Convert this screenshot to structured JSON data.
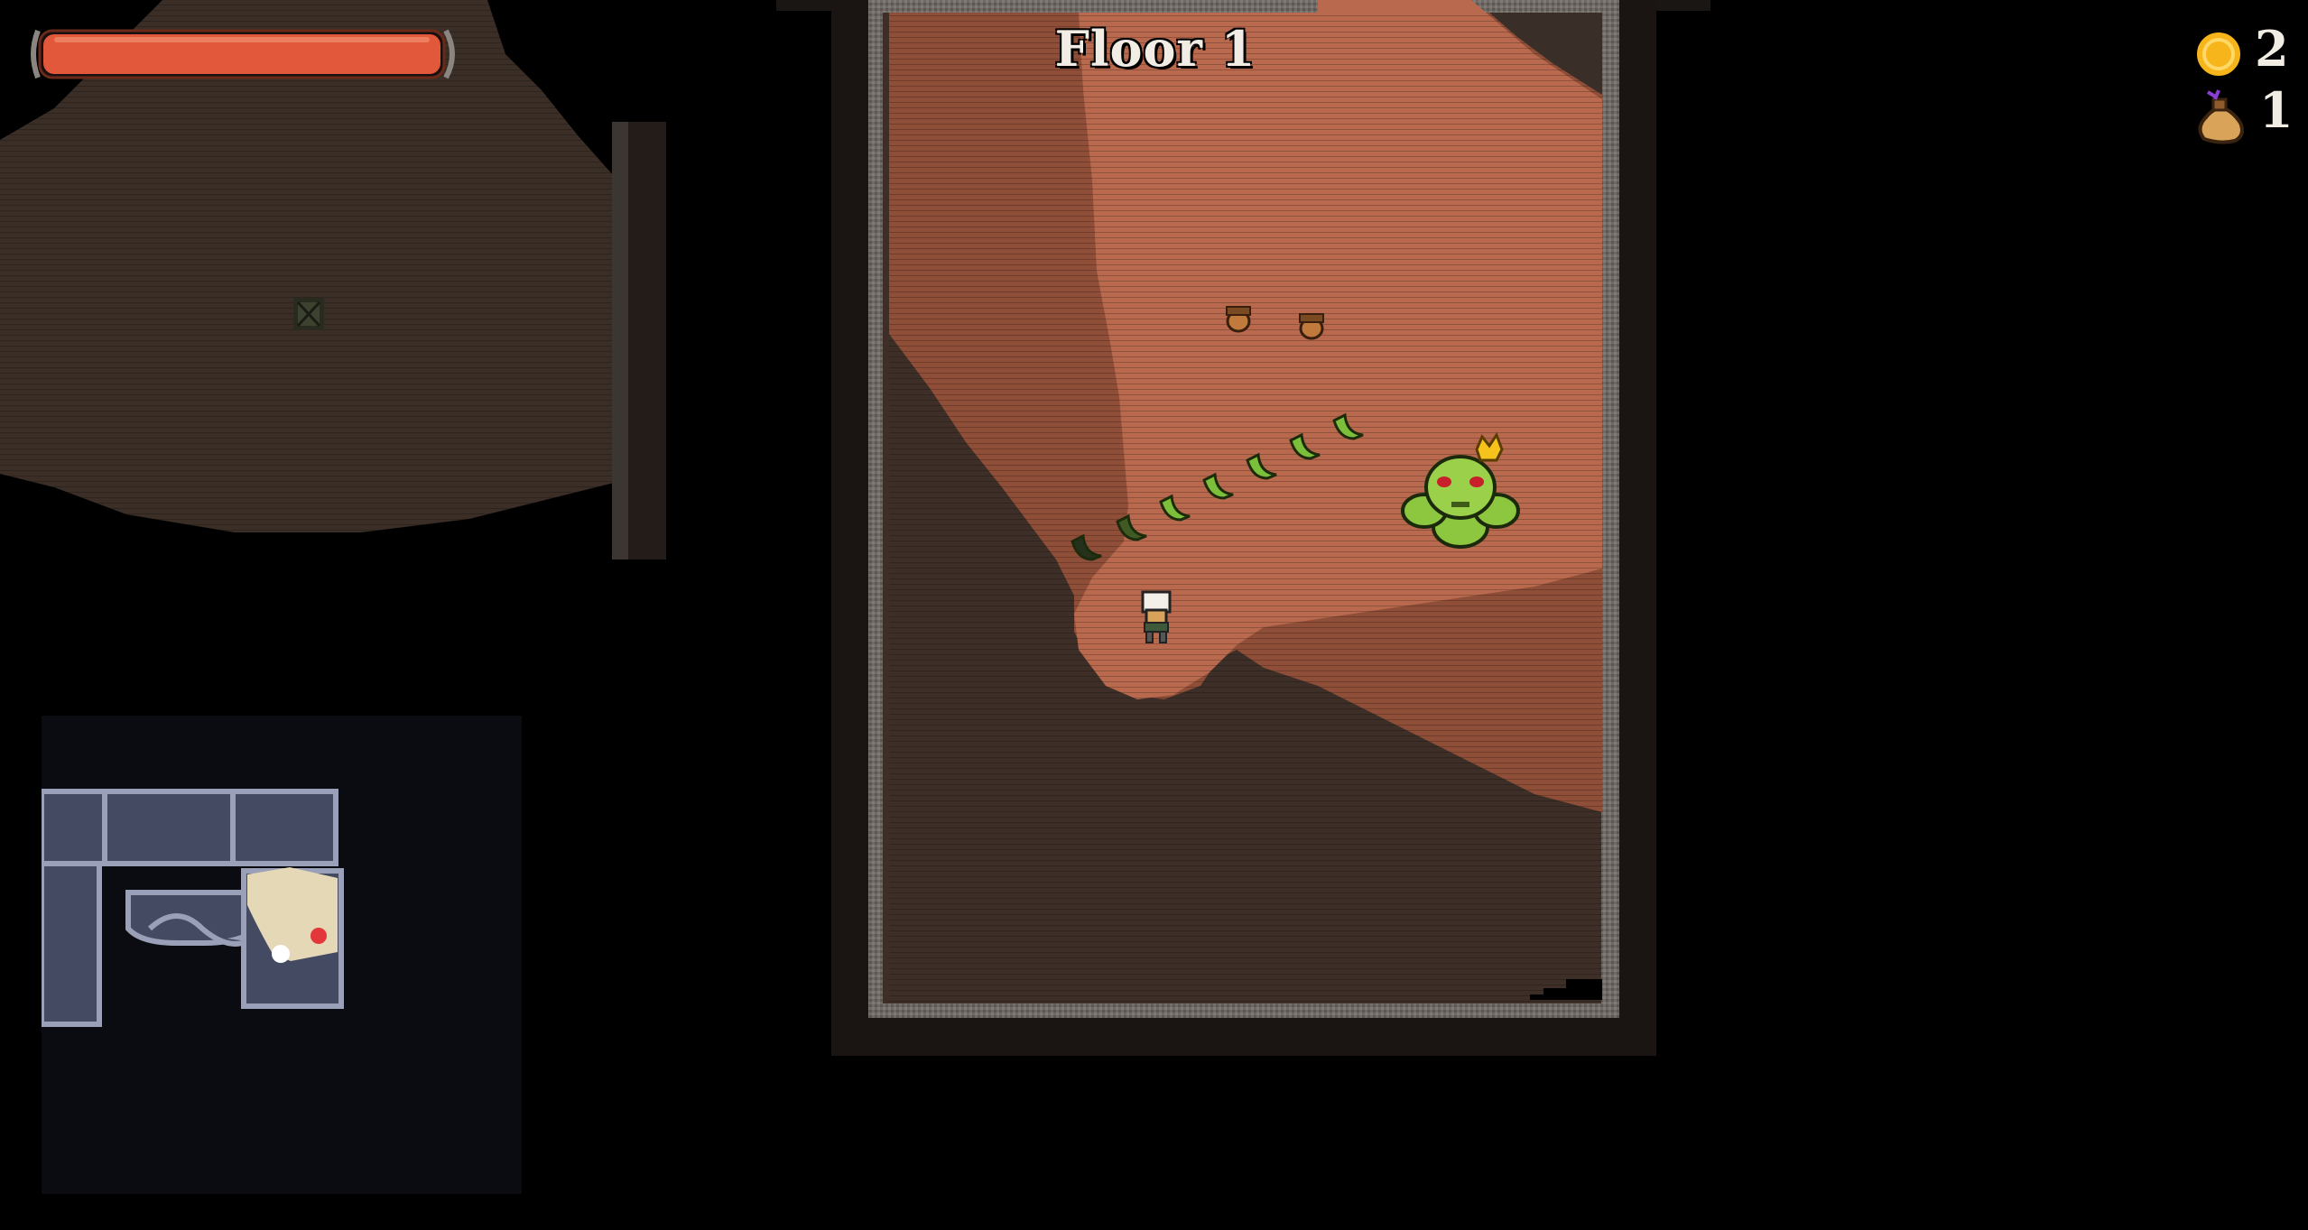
{
  "hud": {
    "floor_label": "Floor 1",
    "coins": "2",
    "potions": "1",
    "health_fraction": 1.0
  },
  "icons": {
    "coin": "gold-coin-icon",
    "potion": "potion-sack-icon",
    "health": "health-bar"
  },
  "colors": {
    "health_fill": "#e2583b",
    "room_floor_lit": "#b9694d",
    "room_floor_dark": "#3a2d26",
    "wall": "#6b6560",
    "minimap_room": "#454a63",
    "minimap_player": "#ffffff",
    "minimap_enemy": "#e2383b",
    "boss_green": "#8dc63f",
    "crown": "#f6c21c"
  },
  "entities": {
    "player": "player-character",
    "boss": "green-slime-king",
    "trail": "green-leaf-trail",
    "pickups": "acorn-pickup"
  }
}
